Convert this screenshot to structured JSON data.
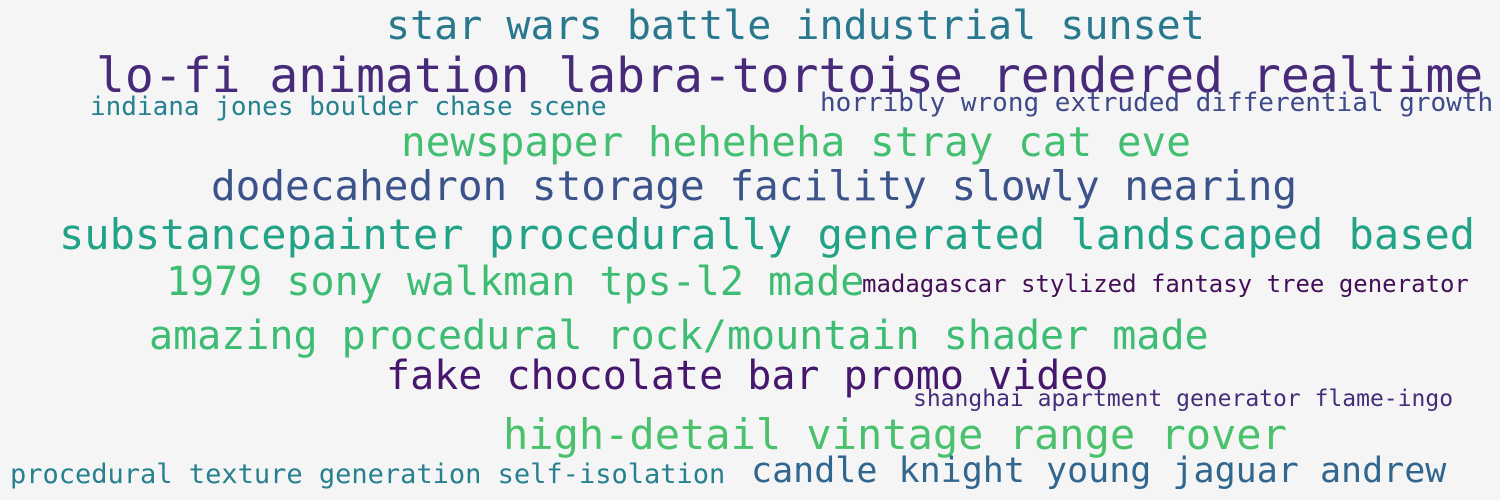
{
  "word_cloud": {
    "background": "#f5f5f5",
    "phrases": [
      {
        "text": "star wars battle industrial sunset",
        "color": "#29788e"
      },
      {
        "text": "lo-fi animation labra-tortoise rendered realtime",
        "color": "#472b7a"
      },
      {
        "text": "indiana jones boulder chase scene",
        "color": "#26828e"
      },
      {
        "text": "horribly wrong extruded differential growth",
        "color": "#3e4a89"
      },
      {
        "text": "newspaper heheheha stray cat eve",
        "color": "#43bf71"
      },
      {
        "text": "dodecahedron storage facility slowly nearing",
        "color": "#3b528b"
      },
      {
        "text": "substancepainter procedurally generated landscaped based",
        "color": "#20a386"
      },
      {
        "text": "1979 sony walkman tps-l2 made",
        "color": "#3dbc74"
      },
      {
        "text": "madagascar stylized fantasy tree generator",
        "color": "#440f57"
      },
      {
        "text": "amazing procedural rock/mountain shader made",
        "color": "#3dbc74"
      },
      {
        "text": "fake chocolate bar promo video",
        "color": "#46176d"
      },
      {
        "text": "shanghai apartment generator flame-ingo",
        "color": "#472c7a"
      },
      {
        "text": "high-detail vintage range rover",
        "color": "#4ac16d"
      },
      {
        "text": "procedural texture generation self-isolation",
        "color": "#27808e"
      },
      {
        "text": "candle knight young jaguar andrew",
        "color": "#31668e"
      }
    ]
  }
}
